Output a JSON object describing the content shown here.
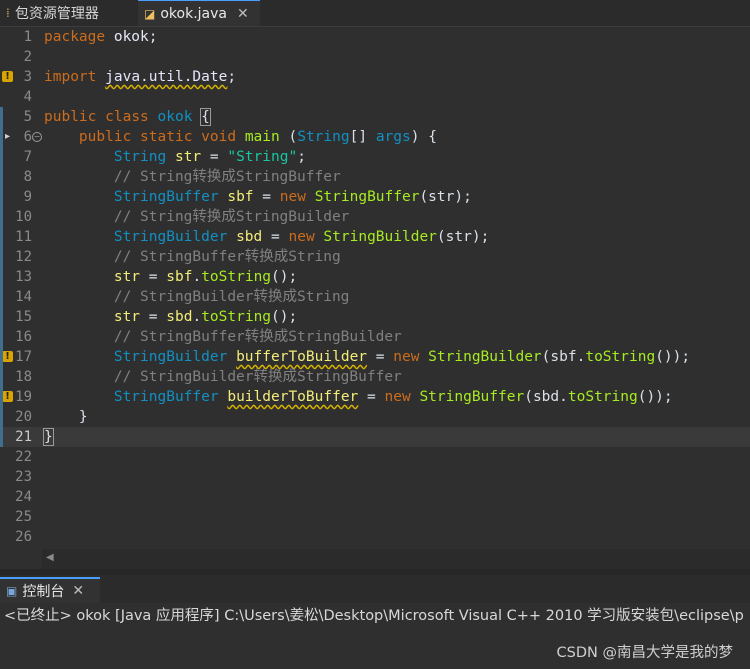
{
  "tabs": {
    "package_explorer": "包资源管理器",
    "editor_file": "okok.java",
    "close_glyph": "✕"
  },
  "code_lines": [
    {
      "n": "1",
      "tokens": [
        {
          "t": "package",
          "c": "kw"
        },
        {
          "t": " "
        },
        {
          "t": "okok",
          "c": "pkgname"
        },
        {
          "t": ";"
        }
      ]
    },
    {
      "n": "2",
      "tokens": []
    },
    {
      "n": "3",
      "tokens": [
        {
          "t": "import",
          "c": "kw"
        },
        {
          "t": " "
        },
        {
          "t": "java.util.Date",
          "c": "pkgname warn"
        },
        {
          "t": ";"
        }
      ]
    },
    {
      "n": "4",
      "tokens": []
    },
    {
      "n": "5",
      "tokens": [
        {
          "t": "public",
          "c": "kw"
        },
        {
          "t": " "
        },
        {
          "t": "class",
          "c": "kw"
        },
        {
          "t": " "
        },
        {
          "t": "okok",
          "c": "tp"
        },
        {
          "t": " "
        },
        {
          "t": "{",
          "c": "bracket"
        }
      ]
    },
    {
      "n": "6",
      "tokens": [
        {
          "t": "    "
        },
        {
          "t": "public",
          "c": "kw"
        },
        {
          "t": " "
        },
        {
          "t": "static",
          "c": "kw"
        },
        {
          "t": " "
        },
        {
          "t": "void",
          "c": "kw"
        },
        {
          "t": " "
        },
        {
          "t": "main",
          "c": "mth"
        },
        {
          "t": " ("
        },
        {
          "t": "String",
          "c": "tp"
        },
        {
          "t": "[] "
        },
        {
          "t": "args",
          "c": "tp"
        },
        {
          "t": ") {"
        }
      ]
    },
    {
      "n": "7",
      "tokens": [
        {
          "t": "        "
        },
        {
          "t": "String",
          "c": "tp"
        },
        {
          "t": " "
        },
        {
          "t": "str",
          "c": "var"
        },
        {
          "t": " = "
        },
        {
          "t": "\"String\"",
          "c": "str"
        },
        {
          "t": ";"
        }
      ]
    },
    {
      "n": "8",
      "tokens": [
        {
          "t": "        "
        },
        {
          "t": "// String转换成StringBuffer",
          "c": "cm"
        }
      ]
    },
    {
      "n": "9",
      "tokens": [
        {
          "t": "        "
        },
        {
          "t": "StringBuffer",
          "c": "tp"
        },
        {
          "t": " "
        },
        {
          "t": "sbf",
          "c": "var"
        },
        {
          "t": " = "
        },
        {
          "t": "new",
          "c": "kw"
        },
        {
          "t": " "
        },
        {
          "t": "StringBuffer",
          "c": "mth"
        },
        {
          "t": "(str);"
        }
      ]
    },
    {
      "n": "10",
      "tokens": [
        {
          "t": "        "
        },
        {
          "t": "// String转换成StringBuilder",
          "c": "cm"
        }
      ]
    },
    {
      "n": "11",
      "tokens": [
        {
          "t": "        "
        },
        {
          "t": "StringBuilder",
          "c": "tp"
        },
        {
          "t": " "
        },
        {
          "t": "sbd",
          "c": "var"
        },
        {
          "t": " = "
        },
        {
          "t": "new",
          "c": "kw"
        },
        {
          "t": " "
        },
        {
          "t": "StringBuilder",
          "c": "mth"
        },
        {
          "t": "(str);"
        }
      ]
    },
    {
      "n": "12",
      "tokens": [
        {
          "t": "        "
        },
        {
          "t": "// StringBuffer转换成String",
          "c": "cm"
        }
      ]
    },
    {
      "n": "13",
      "tokens": [
        {
          "t": "        "
        },
        {
          "t": "str",
          "c": "var"
        },
        {
          "t": " = "
        },
        {
          "t": "sbf",
          "c": "var"
        },
        {
          "t": "."
        },
        {
          "t": "toString",
          "c": "mth"
        },
        {
          "t": "();"
        }
      ]
    },
    {
      "n": "14",
      "tokens": [
        {
          "t": "        "
        },
        {
          "t": "// StringBuilder转换成String",
          "c": "cm"
        }
      ]
    },
    {
      "n": "15",
      "tokens": [
        {
          "t": "        "
        },
        {
          "t": "str",
          "c": "var"
        },
        {
          "t": " = "
        },
        {
          "t": "sbd",
          "c": "var"
        },
        {
          "t": "."
        },
        {
          "t": "toString",
          "c": "mth"
        },
        {
          "t": "();"
        }
      ]
    },
    {
      "n": "16",
      "tokens": [
        {
          "t": "        "
        },
        {
          "t": "// StringBuffer转换成StringBuilder",
          "c": "cm"
        }
      ]
    },
    {
      "n": "17",
      "tokens": [
        {
          "t": "        "
        },
        {
          "t": "StringBuilder",
          "c": "tp"
        },
        {
          "t": " "
        },
        {
          "t": "bufferToBuilder",
          "c": "var warn"
        },
        {
          "t": " = "
        },
        {
          "t": "new",
          "c": "kw"
        },
        {
          "t": " "
        },
        {
          "t": "StringBuilder",
          "c": "mth"
        },
        {
          "t": "("
        },
        {
          "t": "sbf",
          "c": "plain"
        },
        {
          "t": "."
        },
        {
          "t": "toString",
          "c": "mth"
        },
        {
          "t": "());"
        }
      ]
    },
    {
      "n": "18",
      "tokens": [
        {
          "t": "        "
        },
        {
          "t": "// StringBuilder转换成StringBuffer",
          "c": "cm"
        }
      ]
    },
    {
      "n": "19",
      "tokens": [
        {
          "t": "        "
        },
        {
          "t": "StringBuffer",
          "c": "tp"
        },
        {
          "t": " "
        },
        {
          "t": "builderToBuffer",
          "c": "var warn"
        },
        {
          "t": " = "
        },
        {
          "t": "new",
          "c": "kw"
        },
        {
          "t": " "
        },
        {
          "t": "StringBuffer",
          "c": "mth"
        },
        {
          "t": "("
        },
        {
          "t": "sbd",
          "c": "plain"
        },
        {
          "t": "."
        },
        {
          "t": "toString",
          "c": "mth"
        },
        {
          "t": "());"
        }
      ]
    },
    {
      "n": "20",
      "tokens": [
        {
          "t": "    }"
        }
      ]
    },
    {
      "n": "21",
      "tokens": [
        {
          "t": "}",
          "c": "bracket"
        }
      ]
    },
    {
      "n": "22",
      "tokens": []
    },
    {
      "n": "23",
      "tokens": []
    },
    {
      "n": "24",
      "tokens": []
    },
    {
      "n": "25",
      "tokens": []
    },
    {
      "n": "26",
      "tokens": []
    }
  ],
  "markers": {
    "warning_lines": [
      "3",
      "17",
      "19"
    ],
    "breakpoint_lines": [
      "6"
    ],
    "fold_lines": [
      "6"
    ],
    "current_line": "21"
  },
  "console": {
    "tab_label": "控制台",
    "status": "<已终止> okok [Java 应用程序] C:\\Users\\姜松\\Desktop\\Microsoft Visual C++ 2010 学习版安装包\\eclipse\\p"
  },
  "watermark": "CSDN @南昌大学是我的梦",
  "colors": {
    "keyword": "#cc6c1d",
    "type": "#1290c3",
    "comment": "#808080",
    "string": "#17c6a3",
    "variable": "#f3ec79",
    "method": "#a7ec21",
    "accent": "#4a9eff"
  },
  "icons": [
    "package-explorer-icon",
    "java-file-icon",
    "close-icon",
    "warning-icon",
    "breakpoint-icon",
    "fold-icon",
    "scroll-left-icon",
    "console-icon"
  ]
}
